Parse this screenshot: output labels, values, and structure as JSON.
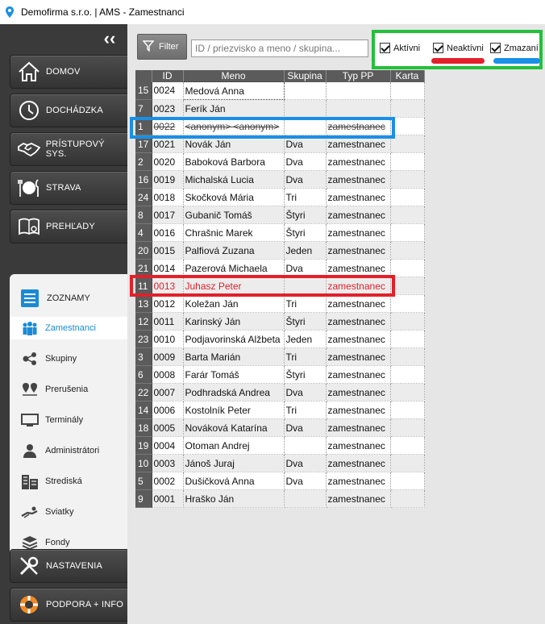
{
  "window": {
    "title": "Demofirma s.r.o. | AMS - Zamestnanci"
  },
  "sidebar": {
    "nav": [
      {
        "label": "DOMOV",
        "icon": "home-icon"
      },
      {
        "label": "DOCHÁDZKA",
        "icon": "clock-icon"
      },
      {
        "label": "PRÍSTUPOVÝ SYS.",
        "icon": "handshake-icon"
      },
      {
        "label": "STRAVA",
        "icon": "plate-icon"
      },
      {
        "label": "PREHĽADY",
        "icon": "book-icon"
      }
    ],
    "section": {
      "label": "ZOZNAMY",
      "icon": "list-icon"
    },
    "items": [
      {
        "label": "Zamestnanci",
        "icon": "people-icon",
        "active": true
      },
      {
        "label": "Skupiny",
        "icon": "nodes-icon"
      },
      {
        "label": "Prerušenia",
        "icon": "pins-icon"
      },
      {
        "label": "Terminály",
        "icon": "monitor-icon"
      },
      {
        "label": "Administrátori",
        "icon": "admin-icon"
      },
      {
        "label": "Strediská",
        "icon": "building-icon"
      },
      {
        "label": "Sviatky",
        "icon": "relax-icon"
      },
      {
        "label": "Fondy",
        "icon": "layers-icon"
      }
    ],
    "bottom": [
      {
        "label": "NASTAVENIA",
        "icon": "tools-icon"
      },
      {
        "label": "PODPORA + INFO",
        "icon": "lifebuoy-icon"
      }
    ]
  },
  "toolbar": {
    "filter_label": "Filter",
    "search_placeholder": "ID / priezvisko a meno / skupina...",
    "checks": [
      {
        "label": "Aktívni",
        "checked": true
      },
      {
        "label": "Neaktívni",
        "checked": true
      },
      {
        "label": "Zmazaní",
        "checked": true
      }
    ]
  },
  "grid": {
    "columns": [
      "ID",
      "Meno",
      "Skupina",
      "Typ PP",
      "Karta"
    ],
    "rows": [
      {
        "n": "15",
        "id": "0024",
        "name": "Medová Anna",
        "group": "",
        "type": "",
        "card": "",
        "state": "active"
      },
      {
        "n": "7",
        "id": "0023",
        "name": "Ferík Ján",
        "group": "",
        "type": "",
        "card": "",
        "state": "active"
      },
      {
        "n": "1",
        "id": "0022",
        "name": "<anonym> <anonym>",
        "group": "",
        "type": "zamestnanec",
        "card": "",
        "state": "deleted"
      },
      {
        "n": "17",
        "id": "0021",
        "name": "Novák Ján",
        "group": "Dva",
        "type": "zamestnanec",
        "card": "",
        "state": "active"
      },
      {
        "n": "2",
        "id": "0020",
        "name": "Baboková Barbora",
        "group": "Dva",
        "type": "zamestnanec",
        "card": "",
        "state": "active"
      },
      {
        "n": "16",
        "id": "0019",
        "name": "Michalská Lucia",
        "group": "Dva",
        "type": "zamestnanec",
        "card": "",
        "state": "active"
      },
      {
        "n": "24",
        "id": "0018",
        "name": "Skočková Mária",
        "group": "Tri",
        "type": "zamestnanec",
        "card": "",
        "state": "active"
      },
      {
        "n": "8",
        "id": "0017",
        "name": "Gubanič Tomáš",
        "group": "Štyri",
        "type": "zamestnanec",
        "card": "",
        "state": "active"
      },
      {
        "n": "4",
        "id": "0016",
        "name": "Chrašnic Marek",
        "group": "Štyri",
        "type": "zamestnanec",
        "card": "",
        "state": "active"
      },
      {
        "n": "20",
        "id": "0015",
        "name": "Palfiová Zuzana",
        "group": "Jeden",
        "type": "zamestnanec",
        "card": "",
        "state": "active"
      },
      {
        "n": "21",
        "id": "0014",
        "name": "Pazerová Michaela",
        "group": "Dva",
        "type": "zamestnanec",
        "card": "",
        "state": "active"
      },
      {
        "n": "11",
        "id": "0013",
        "name": "Juhasz Peter",
        "group": "",
        "type": "zamestnanec",
        "card": "",
        "state": "inactive"
      },
      {
        "n": "13",
        "id": "0012",
        "name": "Koležan Ján",
        "group": "Tri",
        "type": "zamestnanec",
        "card": "",
        "state": "active"
      },
      {
        "n": "12",
        "id": "0011",
        "name": "Karinský Ján",
        "group": "Štyri",
        "type": "zamestnanec",
        "card": "",
        "state": "active"
      },
      {
        "n": "23",
        "id": "0010",
        "name": "Podjavorinská Alžbeta",
        "group": "Jeden",
        "type": "zamestnanec",
        "card": "",
        "state": "active"
      },
      {
        "n": "3",
        "id": "0009",
        "name": "Barta Marián",
        "group": "Tri",
        "type": "zamestnanec",
        "card": "",
        "state": "active"
      },
      {
        "n": "6",
        "id": "0008",
        "name": "Farár Tomáš",
        "group": "Štyri",
        "type": "zamestnanec",
        "card": "",
        "state": "active"
      },
      {
        "n": "22",
        "id": "0007",
        "name": "Podhradská Andrea",
        "group": "Dva",
        "type": "zamestnanec",
        "card": "",
        "state": "active"
      },
      {
        "n": "14",
        "id": "0006",
        "name": "Kostolník Peter",
        "group": "Tri",
        "type": "zamestnanec",
        "card": "",
        "state": "active"
      },
      {
        "n": "18",
        "id": "0005",
        "name": "Nováková Katarína",
        "group": "Dva",
        "type": "zamestnanec",
        "card": "",
        "state": "active"
      },
      {
        "n": "19",
        "id": "0004",
        "name": "Otoman Andrej",
        "group": "",
        "type": "zamestnanec",
        "card": "",
        "state": "active"
      },
      {
        "n": "10",
        "id": "0003",
        "name": "Jánoš Juraj",
        "group": "Dva",
        "type": "zamestnanec",
        "card": "",
        "state": "active"
      },
      {
        "n": "5",
        "id": "0002",
        "name": "Dušičková Anna",
        "group": "Dva",
        "type": "zamestnanec",
        "card": "",
        "state": "active"
      },
      {
        "n": "9",
        "id": "0001",
        "name": "Hraško Ján",
        "group": "",
        "type": "zamestnanec",
        "card": "",
        "state": "active"
      }
    ]
  }
}
